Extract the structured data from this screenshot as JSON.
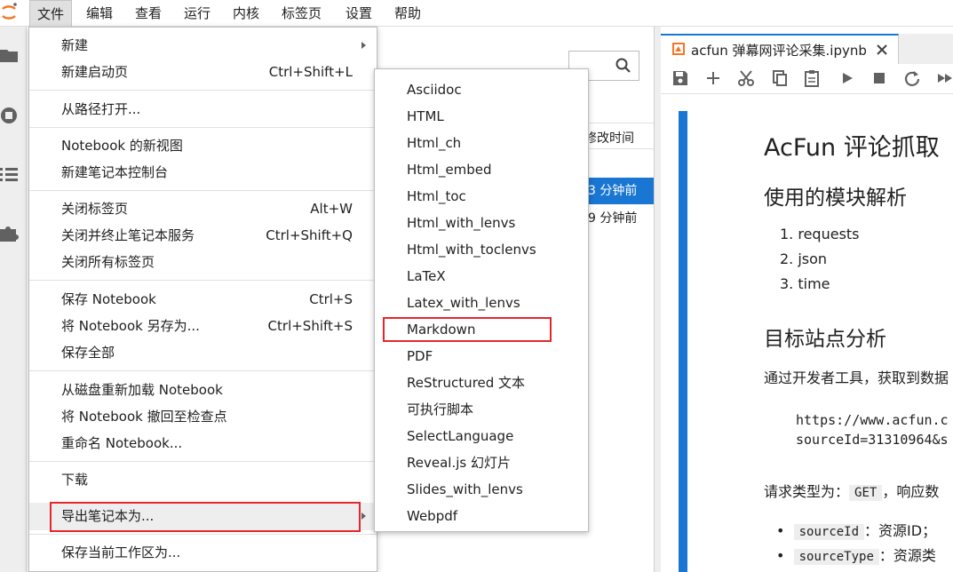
{
  "menubar": {
    "items": [
      "文件",
      "编辑",
      "查看",
      "运行",
      "内核",
      "标签页",
      "设置",
      "帮助"
    ]
  },
  "file_browser": {
    "header_modified": "修改时间",
    "rows": [
      {
        "modified": "3 分钟前",
        "selected": true
      },
      {
        "modified": "9 分钟前",
        "selected": false
      }
    ]
  },
  "notebook": {
    "tab_title": "acfun 弹幕网评论采集.ipynb",
    "h1": "AcFun 评论抓取",
    "h2_modules": "使用的模块解析",
    "modules": [
      "requests",
      "json",
      "time"
    ],
    "h2_target": "目标站点分析",
    "para_devtools": "通过开发者工具，获取到数据",
    "code_lines": [
      "https://www.acfun.c",
      "sourceId=31310964&s"
    ],
    "request_text_prefix": "请求类型为：",
    "request_method": "GET",
    "request_text_suffix": "，响应数",
    "params": [
      {
        "code": "sourceId",
        "desc": "：资源ID；"
      },
      {
        "code": "sourceType",
        "desc": "：资源类"
      }
    ]
  },
  "file_menu": {
    "items": [
      {
        "label": "新建",
        "shortcut": "",
        "submenu": true
      },
      {
        "label": "新建启动页",
        "shortcut": "Ctrl+Shift+L"
      },
      {
        "label": "从路径打开...",
        "shortcut": ""
      },
      {
        "label": "Notebook 的新视图",
        "shortcut": ""
      },
      {
        "label": "新建笔记本控制台",
        "shortcut": ""
      },
      {
        "label": "关闭标签页",
        "shortcut": "Alt+W"
      },
      {
        "label": "关闭并终止笔记本服务",
        "shortcut": "Ctrl+Shift+Q"
      },
      {
        "label": "关闭所有标签页",
        "shortcut": ""
      },
      {
        "label": "保存 Notebook",
        "shortcut": "Ctrl+S"
      },
      {
        "label": "将 Notebook 另存为...",
        "shortcut": "Ctrl+Shift+S"
      },
      {
        "label": "保存全部",
        "shortcut": ""
      },
      {
        "label": "从磁盘重新加载 Notebook",
        "shortcut": ""
      },
      {
        "label": "将 Notebook 撤回至检查点",
        "shortcut": ""
      },
      {
        "label": "重命名 Notebook...",
        "shortcut": ""
      },
      {
        "label": "下载",
        "shortcut": ""
      },
      {
        "label": "导出笔记本为...",
        "shortcut": "",
        "submenu": true,
        "highlighted": true
      },
      {
        "label": "保存当前工作区为...",
        "shortcut": ""
      }
    ]
  },
  "export_submenu": {
    "items": [
      "Asciidoc",
      "HTML",
      "Html_ch",
      "Html_embed",
      "Html_toc",
      "Html_with_lenvs",
      "Html_with_toclenvs",
      "LaTeX",
      "Latex_with_lenvs",
      "Markdown",
      "PDF",
      "ReStructured 文本",
      "可执行脚本",
      "SelectLanguage",
      "Reveal.js 幻灯片",
      "Slides_with_lenvs",
      "Webpdf"
    ],
    "highlighted": "Markdown"
  },
  "colors": {
    "accent": "#1976d2",
    "annotation_red": "#e5262b",
    "menu_hover": "#eeeeee"
  },
  "icons": [
    "jupyter-logo-icon",
    "folder-icon",
    "running-icon",
    "toc-icon",
    "extension-icon",
    "search-icon",
    "notebook-icon",
    "close-icon",
    "save-icon",
    "add-icon",
    "cut-icon",
    "copy-icon",
    "paste-icon",
    "run-icon",
    "stop-icon",
    "restart-icon",
    "fast-forward-icon"
  ]
}
